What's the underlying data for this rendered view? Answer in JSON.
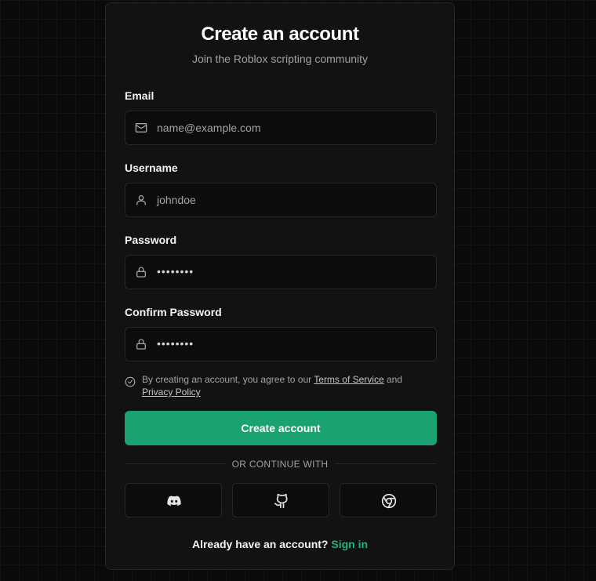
{
  "header": {
    "title": "Create an account",
    "subtitle": "Join the Roblox scripting community"
  },
  "form": {
    "email": {
      "label": "Email",
      "placeholder": "name@example.com",
      "icon": "mail-icon"
    },
    "username": {
      "label": "Username",
      "placeholder": "johndoe",
      "icon": "user-icon"
    },
    "password": {
      "label": "Password",
      "value": "••••••••",
      "icon": "lock-icon"
    },
    "confirm_password": {
      "label": "Confirm Password",
      "value": "••••••••",
      "icon": "lock-icon"
    }
  },
  "terms": {
    "prefix": "By creating an account, you agree to our ",
    "tos": "Terms of Service",
    "and": " and",
    "privacy": "Privacy Policy",
    "icon": "check-circle-icon"
  },
  "submit_label": "Create account",
  "divider_label": "OR CONTINUE WITH",
  "social": [
    {
      "name": "discord",
      "icon": "discord-icon"
    },
    {
      "name": "github",
      "icon": "github-icon"
    },
    {
      "name": "google",
      "icon": "chrome-icon"
    }
  ],
  "footer": {
    "question": "Already have an account?",
    "signin": "Sign in"
  },
  "colors": {
    "accent": "#1aa371",
    "link": "#1fb37b",
    "background": "#0a0a0a",
    "card": "#121212"
  }
}
